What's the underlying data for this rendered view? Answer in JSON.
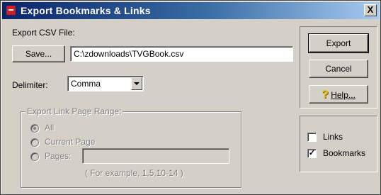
{
  "window": {
    "title": "Export Bookmarks & Links",
    "close_glyph": "X"
  },
  "csv": {
    "label": "Export CSV File:",
    "save_button": "Save...",
    "path_value": "C:\\zdownloads\\TVGBook.csv"
  },
  "delimiter": {
    "label": "Delimiter:",
    "selected": "Comma"
  },
  "range": {
    "title": "Export Link Page Range:",
    "options": [
      "All",
      "Current Page",
      "Pages:"
    ],
    "selected_index": 0,
    "pages_value": "",
    "hint": "( For example, 1,5,10-14 )"
  },
  "actions": {
    "export": "Export",
    "cancel": "Cancel",
    "help": "Help..."
  },
  "include": {
    "links_label": "Links",
    "links_checked": false,
    "bookmarks_label": "Bookmarks",
    "bookmarks_checked": true
  },
  "icons": {
    "app": "app-icon",
    "help": "help-question-icon"
  }
}
